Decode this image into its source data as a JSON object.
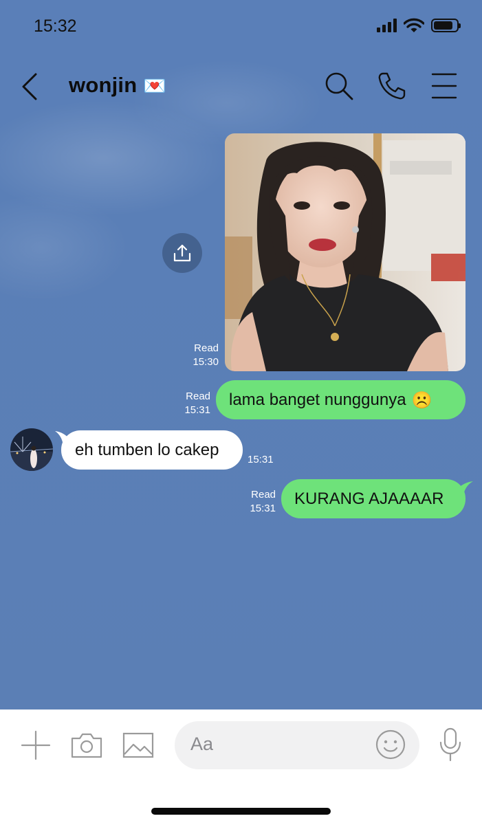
{
  "status_bar": {
    "time": "15:32",
    "battery_level_pct": 85
  },
  "header": {
    "title": "wonjin",
    "title_emoji": "💌",
    "icons": [
      "back-icon",
      "search-icon",
      "phone-icon",
      "menu-icon"
    ]
  },
  "messages": [
    {
      "direction": "out",
      "type": "photo",
      "status": "Read",
      "time": "15:30"
    },
    {
      "direction": "out",
      "type": "text",
      "text": "lama banget nunggunya",
      "emoji": "☹️",
      "status": "Read",
      "time": "15:31"
    },
    {
      "direction": "in",
      "type": "text",
      "text": "eh tumben lo cakep",
      "time": "15:31"
    },
    {
      "direction": "out",
      "type": "text",
      "text": "KURANG AJAAAAR",
      "status": "Read",
      "time": "15:31"
    }
  ],
  "input": {
    "placeholder": "Aa",
    "icons": [
      "plus-icon",
      "camera-icon",
      "image-icon",
      "emoji-icon",
      "microphone-icon"
    ]
  },
  "colors": {
    "chat_background": "#5b7fb5",
    "outgoing_bubble": "#6ee27a",
    "incoming_bubble": "#ffffff"
  }
}
